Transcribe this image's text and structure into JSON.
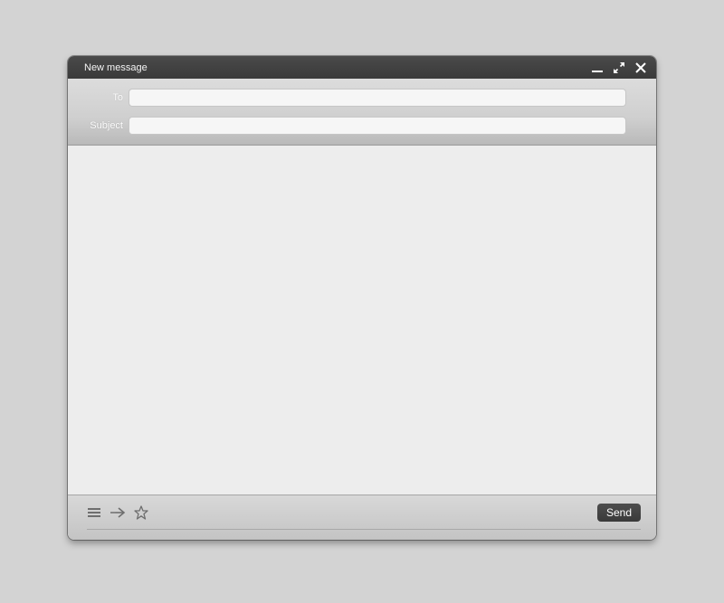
{
  "window": {
    "title": "New message"
  },
  "fields": {
    "to": {
      "label": "To",
      "value": "",
      "placeholder": ""
    },
    "subject": {
      "label": "Subject",
      "value": "",
      "placeholder": ""
    }
  },
  "body": {
    "value": ""
  },
  "footer": {
    "tools": [
      "menu-icon",
      "forward-arrow-icon",
      "star-icon"
    ],
    "send_label": "Send"
  },
  "colors": {
    "titlebar": "#3f3f3f",
    "background": "#d3d3d3",
    "body": "#ededed",
    "send_button": "#434343"
  }
}
